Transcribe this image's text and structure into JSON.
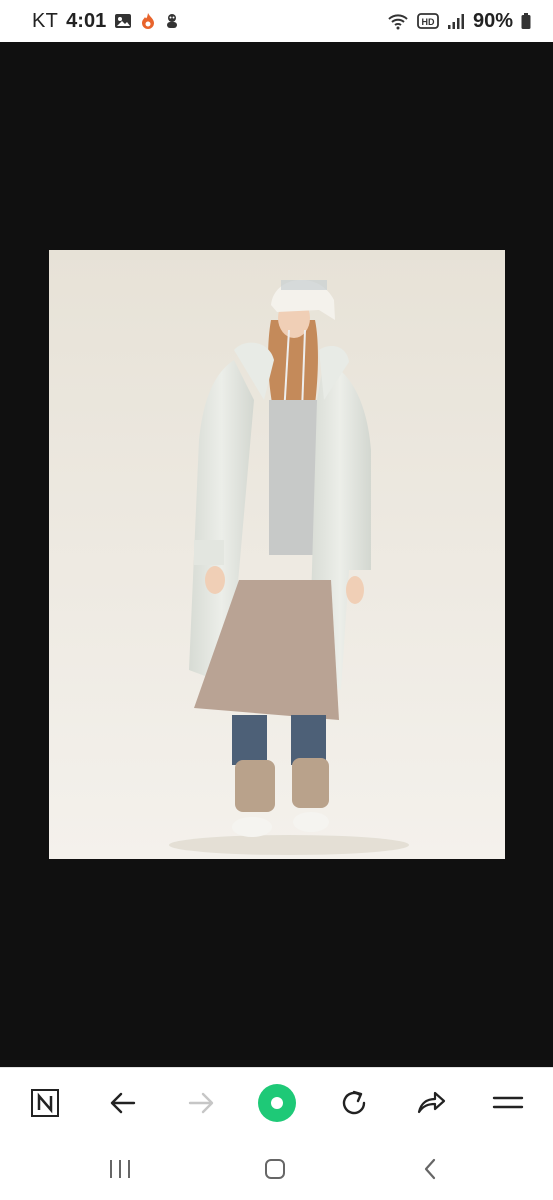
{
  "status_bar": {
    "carrier": "KT",
    "time": "4:01",
    "battery": "90%",
    "icons": [
      "gallery-icon",
      "fire-app-icon",
      "game-app-icon",
      "wifi-icon",
      "hd-voice-icon",
      "signal-icon",
      "battery-icon"
    ]
  },
  "image": {
    "subject": "model-in-long-white-padded-coat"
  },
  "toolbar": {
    "buttons": [
      "naver-home-icon",
      "back-arrow-icon",
      "forward-arrow-icon",
      "green-dot-button",
      "reload-icon",
      "share-icon",
      "menu-icon"
    ],
    "accent_color": "#1ec977"
  },
  "system_nav": {
    "buttons": [
      "recents-icon",
      "home-icon",
      "back-icon"
    ]
  }
}
